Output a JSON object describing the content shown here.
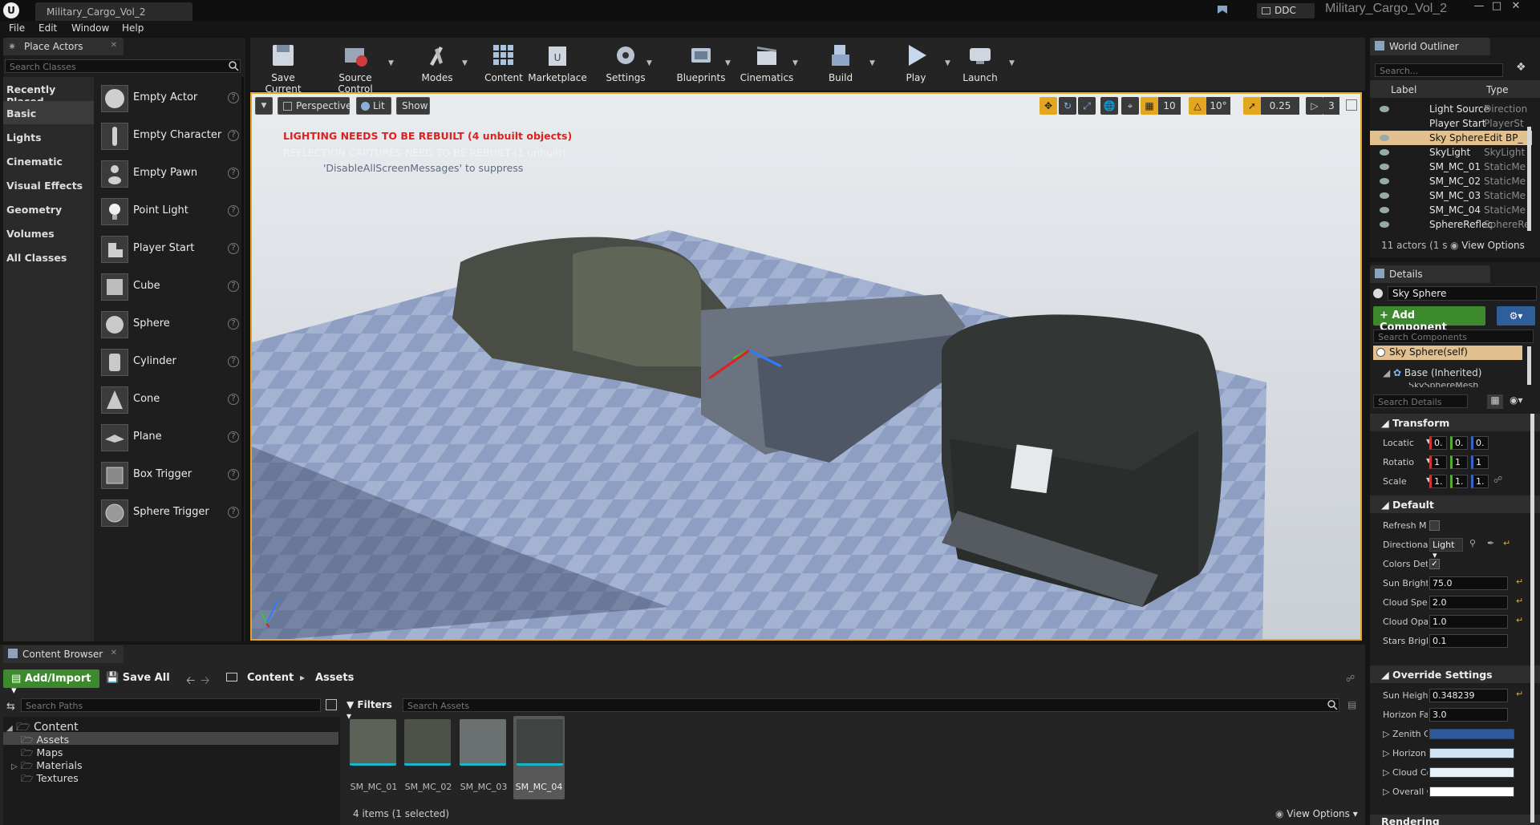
{
  "window": {
    "tab_title": "Military_Cargo_Vol_2",
    "title": "Military_Cargo_Vol_2",
    "ddc_label": "DDC"
  },
  "menu": [
    "File",
    "Edit",
    "Window",
    "Help"
  ],
  "place_actors": {
    "tab": "Place Actors",
    "search_placeholder": "Search Classes",
    "categories": [
      "Recently Placed",
      "Basic",
      "Lights",
      "Cinematic",
      "Visual Effects",
      "Geometry",
      "Volumes",
      "All Classes"
    ],
    "selected_category": "Basic",
    "items": [
      "Empty Actor",
      "Empty Character",
      "Empty Pawn",
      "Point Light",
      "Player Start",
      "Cube",
      "Sphere",
      "Cylinder",
      "Cone",
      "Plane",
      "Box Trigger",
      "Sphere Trigger"
    ]
  },
  "toolbar": {
    "buttons": [
      "Save Current",
      "Source Control",
      "Modes",
      "Content",
      "Marketplace",
      "Settings",
      "Blueprints",
      "Cinematics",
      "Build",
      "Play",
      "Launch"
    ]
  },
  "viewport": {
    "perspective": "Perspective",
    "lit": "Lit",
    "show": "Show",
    "grid_snap": "10",
    "rot_snap": "10°",
    "scale_snap": "0.25",
    "cam_speed": "3",
    "messages": {
      "lighting": "LIGHTING NEEDS TO BE REBUILT (4 unbuilt objects)",
      "reflection": "REFLECTION CAPTURES NEED TO BE REBUILT (1 unbuilt)",
      "disable": "'DisableAllScreenMessages' to suppress"
    },
    "colors": {
      "warning": "#ff2a2a",
      "highlight": "#e3a61f"
    }
  },
  "outliner": {
    "tab": "World Outliner",
    "search_placeholder": "Search...",
    "col_label": "Label",
    "col_type": "Type",
    "rows": [
      {
        "label": "Light Source",
        "type": "Direction"
      },
      {
        "label": "Player Start",
        "type": "PlayerSt"
      },
      {
        "label": "Sky Sphere",
        "type": "Edit BP_"
      },
      {
        "label": "SkyLight",
        "type": "SkyLight"
      },
      {
        "label": "SM_MC_01",
        "type": "StaticMe"
      },
      {
        "label": "SM_MC_02",
        "type": "StaticMe"
      },
      {
        "label": "SM_MC_03",
        "type": "StaticMe"
      },
      {
        "label": "SM_MC_04",
        "type": "StaticMe"
      },
      {
        "label": "SphereReflec",
        "type": "SphereRe"
      }
    ],
    "selected_row": 2,
    "footer": "11 actors (1 s",
    "view_options": "View Options"
  },
  "details": {
    "tab": "Details",
    "name": "Sky Sphere",
    "add_component": "+ Add Component",
    "search_components": "Search Components",
    "self_row": "Sky Sphere(self)",
    "base_row": "Base (Inherited)",
    "partial_row": "SkySphereMesh (Inherited)",
    "search_details": "Search Details",
    "transform_section": "Transform",
    "transform": [
      {
        "label": "Locatic",
        "values": [
          "0.",
          "0.",
          "0."
        ]
      },
      {
        "label": "Rotatio",
        "values": [
          "1",
          "1",
          "1"
        ]
      },
      {
        "label": "Scale",
        "values": [
          "1.",
          "1.",
          "1."
        ]
      }
    ],
    "default_section": "Default",
    "refresh": "Refresh M",
    "directional": "Directiona",
    "directional_value": "Light",
    "colors_det": "Colors Det",
    "props": [
      {
        "label": "Sun Bright",
        "value": "75.0"
      },
      {
        "label": "Cloud Spe",
        "value": "2.0"
      },
      {
        "label": "Cloud Opa",
        "value": "1.0"
      },
      {
        "label": "Stars Brigl",
        "value": "0.1"
      }
    ],
    "override_section": "Override Settings",
    "override_props": [
      {
        "label": "Sun Heigh",
        "value": "0.348239"
      },
      {
        "label": "Horizon Fa",
        "value": "3.0"
      }
    ],
    "color_props": [
      {
        "label": "Zenith Col",
        "color": "#2c5a9c"
      },
      {
        "label": "Horizon C",
        "color": "#cfe3f3"
      },
      {
        "label": "Cloud Colc",
        "color": "#e8f1f8"
      },
      {
        "label": "Overall Cc",
        "color": "#ffffff"
      }
    ],
    "rendering_section": "Rendering"
  },
  "content_browser": {
    "tab": "Content Browser",
    "add_import": "Add/Import",
    "save_all": "Save All",
    "path": [
      "Content",
      "Assets"
    ],
    "search_paths": "Search Paths",
    "filters": "Filters",
    "search_assets": "Search Assets",
    "tree": {
      "root": "Content",
      "children": [
        "Assets",
        "Maps",
        "Materials",
        "Textures"
      ],
      "selected": "Assets"
    },
    "assets": [
      "SM_MC_01",
      "SM_MC_02",
      "SM_MC_03",
      "SM_MC_04"
    ],
    "selected_asset": 3,
    "status": "4 items (1 selected)",
    "view_options": "View Options"
  }
}
